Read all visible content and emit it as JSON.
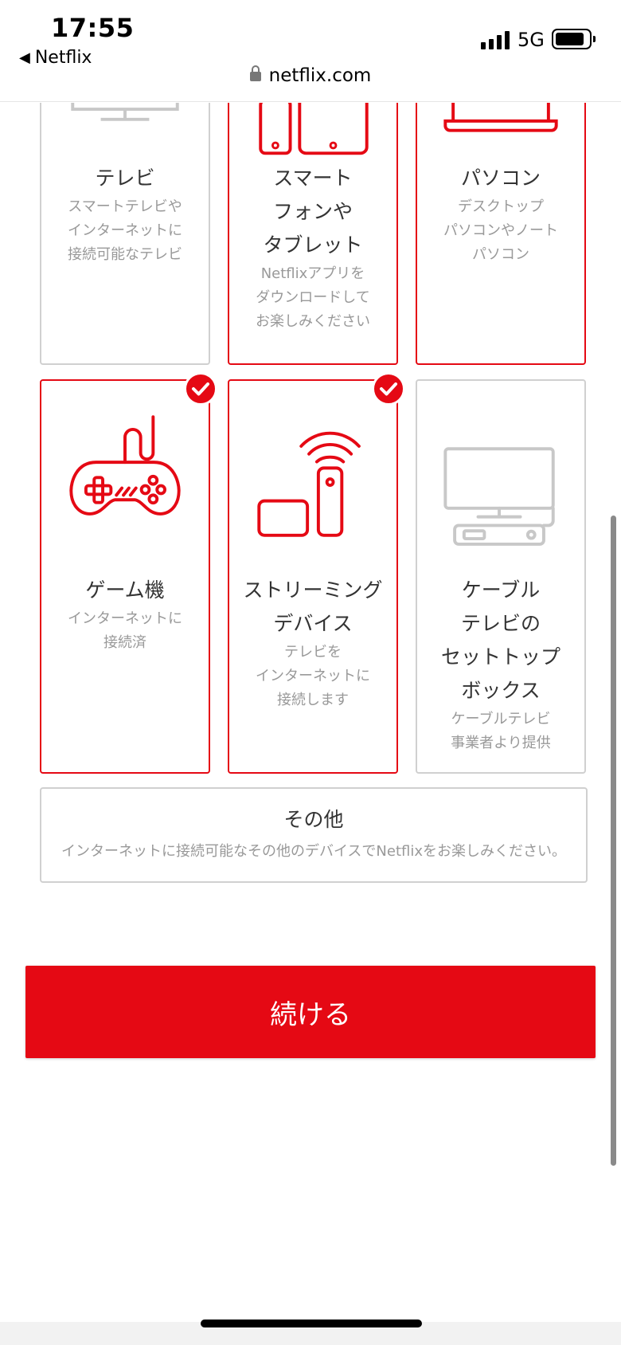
{
  "status": {
    "time": "17:55",
    "back_app": "Netflix",
    "network": "5G"
  },
  "browser": {
    "url": "netflix.com"
  },
  "devices": [
    {
      "title": "テレビ",
      "desc": [
        "スマートテレビや",
        "インターネットに",
        "接続可能なテレビ"
      ],
      "icon": "tv-icon",
      "selected": false
    },
    {
      "title": [
        "スマート",
        "フォンや",
        "タブレット"
      ],
      "desc": [
        "Netflixアプリを",
        "ダウンロードして",
        "お楽しみください"
      ],
      "icon": "phone-tablet-icon",
      "selected": true
    },
    {
      "title": "パソコン",
      "desc": [
        "デスクトップ",
        "パソコンやノート",
        "パソコン"
      ],
      "icon": "laptop-icon",
      "selected": true
    },
    {
      "title": "ゲーム機",
      "desc": [
        "インターネットに",
        "接続済"
      ],
      "icon": "game-controller-icon",
      "selected": true,
      "checked": true
    },
    {
      "title": [
        "ストリーミング",
        "デバイス"
      ],
      "desc": [
        "テレビを",
        "インターネットに",
        "接続します"
      ],
      "icon": "streaming-device-icon",
      "selected": true,
      "checked": true
    },
    {
      "title": [
        "ケーブル",
        "テレビの",
        "セットトップ",
        "ボックス"
      ],
      "desc": [
        "ケーブルテレビ",
        "事業者より提供"
      ],
      "icon": "set-top-box-icon",
      "selected": false
    }
  ],
  "other": {
    "title": "その他",
    "desc": "インターネットに接続可能なその他のデバイスでNetflixをお楽しみください。"
  },
  "continue_label": "続ける",
  "colors": {
    "accent": "#e50914",
    "unselected_border": "#d0d0d0"
  }
}
